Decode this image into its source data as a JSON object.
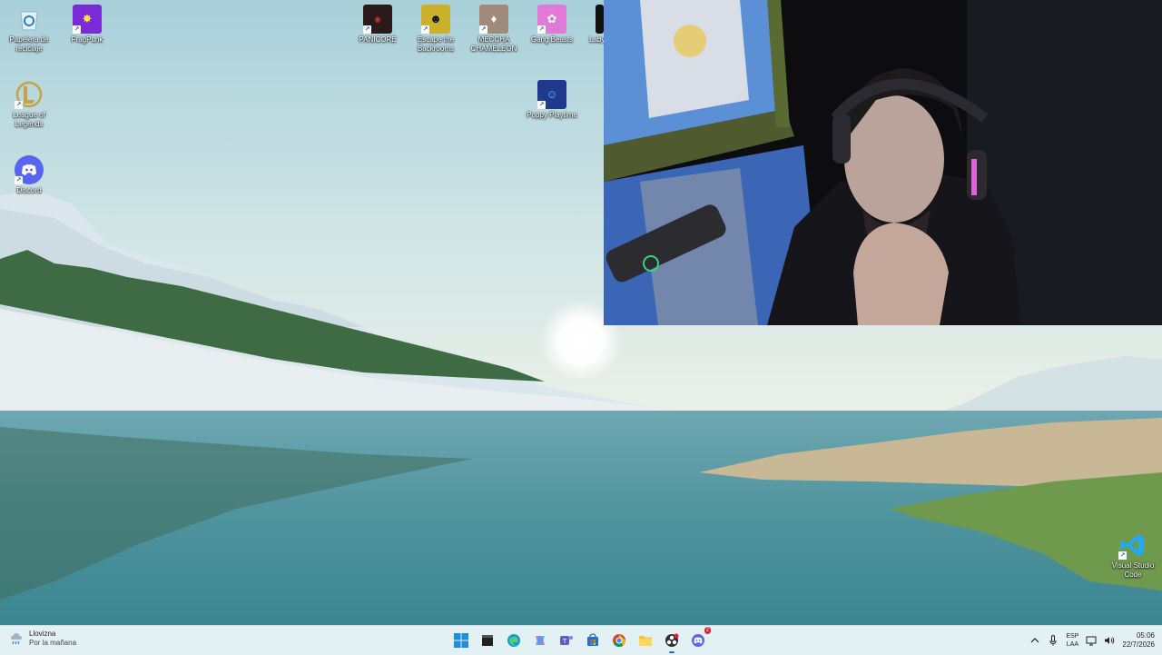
{
  "desktop": {
    "icons": [
      {
        "label": "Papelera de reciclaje",
        "icon": "recycle-bin-icon"
      },
      {
        "label": "FragPunk",
        "icon": "fragpunk-icon"
      },
      {
        "label": "League of Legends",
        "icon": "league-of-legends-icon"
      },
      {
        "label": "Discord",
        "icon": "discord-icon"
      },
      {
        "label": "PANICORE",
        "icon": "panicore-icon"
      },
      {
        "label": "Escape the Backrooms",
        "icon": "escape-backrooms-icon"
      },
      {
        "label": "MECCHA CHAMELEON",
        "icon": "meccha-chameleon-icon"
      },
      {
        "label": "Gang Beasts",
        "icon": "gang-beasts-icon"
      },
      {
        "label": "Laby",
        "icon": "laby-icon"
      },
      {
        "label": "Poppy Playtime",
        "icon": "poppy-playtime-icon"
      },
      {
        "label": "Visual Studio Code",
        "icon": "vscode-icon"
      }
    ]
  },
  "taskbar": {
    "weather": {
      "title": "Llovizna",
      "subtitle": "Por la mañana",
      "icon": "drizzle-icon"
    },
    "apps": [
      {
        "name": "start",
        "icon": "windows-start-icon"
      },
      {
        "name": "terminal",
        "icon": "terminal-icon"
      },
      {
        "name": "edge",
        "icon": "edge-icon"
      },
      {
        "name": "copilot",
        "icon": "copilot-icon"
      },
      {
        "name": "teams",
        "icon": "teams-icon"
      },
      {
        "name": "store",
        "icon": "store-icon"
      },
      {
        "name": "chrome",
        "icon": "chrome-icon"
      },
      {
        "name": "file-explorer",
        "icon": "folder-icon"
      },
      {
        "name": "obs",
        "icon": "obs-icon"
      },
      {
        "name": "discord",
        "icon": "discord-icon",
        "badge": "2"
      }
    ],
    "tray": {
      "lang_top": "ESP",
      "lang_bottom": "LAA",
      "time": "05:06",
      "date": "22/7/2026"
    }
  },
  "colors": {
    "taskbar": "#e4f1f4",
    "accent": "#1b6ec2"
  }
}
